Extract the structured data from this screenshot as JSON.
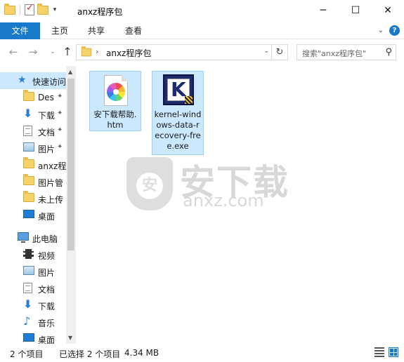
{
  "window": {
    "title": "anxz程序包",
    "minimize_glyph": "─",
    "maximize_glyph": "☐",
    "close_glyph": "✕"
  },
  "quick_access_toolbar": {
    "icons": [
      "folder-icon",
      "properties-check-icon",
      "new-folder-icon"
    ],
    "dropdown_glyph": "▾"
  },
  "ribbon": {
    "tabs": [
      {
        "label": "文件",
        "active": true
      },
      {
        "label": "主页"
      },
      {
        "label": "共享"
      },
      {
        "label": "查看"
      }
    ],
    "expand_glyph": "⌄",
    "help_glyph": "?",
    "accent_color": "#1979ca"
  },
  "address_bar": {
    "back_glyph": "←",
    "forward_glyph": "→",
    "recent_glyph": "⌄",
    "up_glyph": "↑",
    "separator": "›",
    "path": "anxz程序包",
    "dropdown_glyph": "⌄",
    "refresh_glyph": "↻"
  },
  "search": {
    "placeholder": "搜索\"anxz程序包\"",
    "icon": "search-icon",
    "glyph": "⚲"
  },
  "nav_pane": {
    "quick_access": {
      "label": "快速访问",
      "icon": "star-icon"
    },
    "pinned": [
      {
        "label": "Des",
        "icon": "folder-icon",
        "pinned": true
      },
      {
        "label": "下载",
        "icon": "download-icon",
        "pinned": true
      },
      {
        "label": "文档",
        "icon": "document-icon",
        "pinned": true
      },
      {
        "label": "图片",
        "icon": "pictures-icon",
        "pinned": true
      },
      {
        "label": "anxz程",
        "icon": "folder-icon"
      },
      {
        "label": "图片管",
        "icon": "folder-icon"
      },
      {
        "label": "未上传",
        "icon": "folder-icon"
      },
      {
        "label": "桌面",
        "icon": "desktop-icon"
      }
    ],
    "this_pc": {
      "label": "此电脑",
      "icon": "computer-icon"
    },
    "pc_items": [
      {
        "label": "视频",
        "icon": "video-icon"
      },
      {
        "label": "图片",
        "icon": "pictures-icon"
      },
      {
        "label": "文档",
        "icon": "document-icon"
      },
      {
        "label": "下载",
        "icon": "download-icon"
      },
      {
        "label": "音乐",
        "icon": "music-icon"
      },
      {
        "label": "桌面",
        "icon": "desktop-icon"
      }
    ],
    "pin_glyph": "📌"
  },
  "files": [
    {
      "name": "安下载帮助.htm",
      "icon": "htm-file-icon",
      "selected": true
    },
    {
      "name": "kernel-windows-data-recovery-free.exe",
      "icon": "kernel-app-icon",
      "icon_letter": "K",
      "selected": true
    }
  ],
  "watermark": {
    "title": "安下载",
    "url": "anxz.com",
    "shield_glyph": "安"
  },
  "status_bar": {
    "item_count": "2 个项目",
    "selected": "已选择 2 个项目",
    "size": "4.34 MB"
  }
}
